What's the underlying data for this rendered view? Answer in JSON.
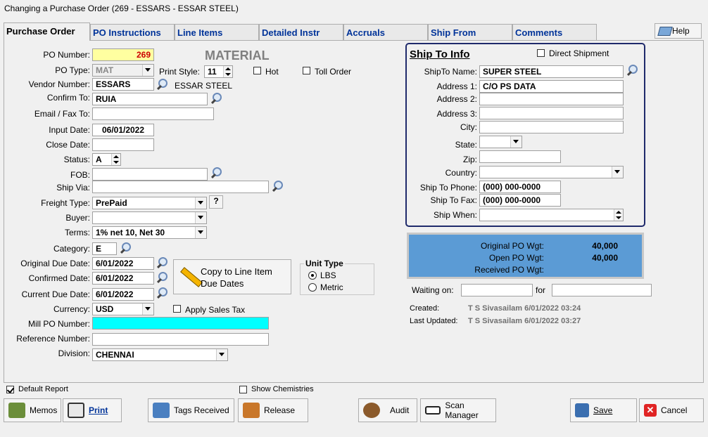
{
  "window_title": "Changing a Purchase Order  (269 - ESSARS -  ESSAR STEEL)",
  "tabs": [
    "Purchase Order",
    "PO Instructions",
    "Line Items",
    "Detailed Instr",
    "Accruals",
    "Ship From",
    "Comments"
  ],
  "help_label": "Help",
  "form": {
    "po_number_label": "PO Number:",
    "po_number": "269",
    "material_caption": "MATERIAL",
    "po_type_label": "PO Type:",
    "po_type": "MAT",
    "print_style_label": "Print Style:",
    "print_style": "11",
    "hot_label": "Hot",
    "toll_order_label": "Toll Order",
    "vendor_number_label": "Vendor Number:",
    "vendor_number": "ESSARS",
    "vendor_name": "ESSAR STEEL",
    "confirm_to_label": "Confirm To:",
    "confirm_to": "RUIA",
    "email_fax_label": "Email / Fax To:",
    "email_fax": "",
    "input_date_label": "Input Date:",
    "input_date": "06/01/2022",
    "close_date_label": "Close Date:",
    "close_date": "",
    "status_label": "Status:",
    "status": "A",
    "fob_label": "FOB:",
    "fob": "",
    "ship_via_label": "Ship Via:",
    "ship_via": "",
    "freight_type_label": "Freight Type:",
    "freight_type": "PrePaid",
    "question_label": "?",
    "buyer_label": "Buyer:",
    "buyer": "",
    "terms_label": "Terms:",
    "terms": "1% net 10, Net 30",
    "category_label": "Category:",
    "category": "E",
    "orig_due_label": "Original Due Date:",
    "orig_due": "6/01/2022",
    "conf_date_label": "Confirmed Date:",
    "conf_date": "6/01/2022",
    "curr_due_label": "Current Due Date:",
    "curr_due": "6/01/2022",
    "copy_btn_line1": "Copy to Line Item",
    "copy_btn_line2": "Due Dates",
    "unit_type_label": "Unit Type",
    "unit_lbs": "LBS",
    "unit_metric": "Metric",
    "currency_label": "Currency:",
    "currency": "USD",
    "apply_tax_label": "Apply Sales Tax",
    "mill_po_label": "Mill PO Number:",
    "mill_po": "",
    "reference_label": "Reference Number:",
    "reference": "",
    "division_label": "Division:",
    "division": "CHENNAI"
  },
  "ship_to": {
    "title": "Ship To Info",
    "direct_shipment_label": "Direct Shipment",
    "name_label": "ShipTo Name:",
    "name": "SUPER STEEL",
    "addr1_label": "Address 1:",
    "addr1": "C/O PS DATA",
    "addr2_label": "Address 2:",
    "addr2": "",
    "addr3_label": "Address 3:",
    "addr3": "",
    "city_label": "City:",
    "city": "",
    "state_label": "State:",
    "state": "",
    "zip_label": "Zip:",
    "zip": "",
    "country_label": "Country:",
    "country": "",
    "phone_label": "Ship To Phone:",
    "phone": "(000) 000-0000",
    "fax_label": "Ship To Fax:",
    "fax": "(000) 000-0000",
    "when_label": "Ship When:",
    "when": ""
  },
  "weights": {
    "orig_label": "Original PO Wgt:",
    "orig": "40,000",
    "open_label": "Open PO Wgt:",
    "open": "40,000",
    "recv_label": "Received PO Wgt:",
    "recv": ""
  },
  "waiting": {
    "label": "Waiting on:",
    "value": "",
    "for_label": "for",
    "for_value": ""
  },
  "audit_info": {
    "created_label": "Created:",
    "created": "T S Sivasailam 6/01/2022 03:24",
    "updated_label": "Last Updated:",
    "updated": "T S Sivasailam 6/01/2022 03:27"
  },
  "footer": {
    "default_report_label": "Default Report",
    "show_chem_label": "Show Chemistries",
    "memos": "Memos",
    "print": "Print",
    "tags_received": "Tags Received",
    "release": "Release",
    "audit": "Audit",
    "scan_manager": "Scan Manager",
    "save": "Save",
    "cancel": "Cancel"
  },
  "colors": {
    "po_number_bg": "#ffffa0",
    "po_number_text": "#cc0000",
    "mill_po_bg": "#00ffff",
    "weights_bg": "#5b9bd5",
    "tab_text": "#003399",
    "ship_to_border": "#1f2a6b"
  }
}
